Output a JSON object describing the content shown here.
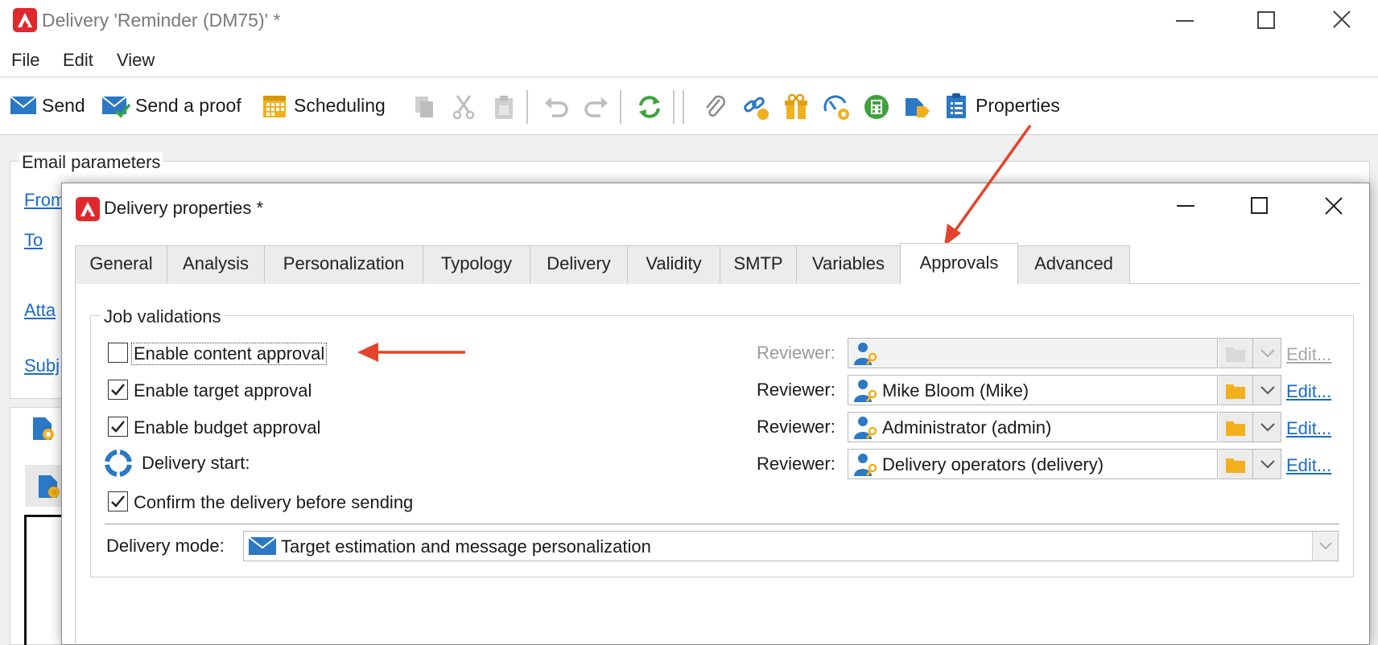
{
  "colors": {
    "accent_red": "#e0282d",
    "link_blue": "#1b6ac9",
    "annotation_arrow": "#e5432b",
    "icon_blue": "#2b78c5",
    "icon_yellow": "#f2b01e",
    "icon_green": "#3ea33a"
  },
  "main_window": {
    "title": "Delivery 'Reminder (DM75)' *",
    "logo_icon": "adobe-campaign-logo-icon",
    "controls": [
      "minimize-icon",
      "maximize-icon",
      "close-icon"
    ]
  },
  "menu": {
    "items": [
      "File",
      "Edit",
      "View"
    ]
  },
  "toolbar": {
    "send_label": "Send",
    "send_proof_label": "Send a proof",
    "scheduling_label": "Scheduling",
    "properties_label": "Properties",
    "icons": [
      "send-icon",
      "send-proof-icon",
      "scheduling-icon",
      "copy-icon",
      "cut-icon",
      "paste-icon",
      "undo-icon",
      "redo-icon",
      "refresh-icon",
      "attachment-icon",
      "link-icon",
      "offers-icon",
      "audit-icon",
      "calculator-icon",
      "tags-icon",
      "properties-icon"
    ]
  },
  "background_form": {
    "group_title": "Email parameters",
    "links": [
      "From",
      "To",
      "Atta",
      "Subj"
    ]
  },
  "dialog": {
    "title": "Delivery properties *",
    "tabs": [
      "General",
      "Analysis",
      "Personalization",
      "Typology",
      "Delivery",
      "Validity",
      "SMTP",
      "Variables",
      "Approvals",
      "Advanced"
    ],
    "active_tab": "Approvals",
    "job_validations": {
      "title": "Job validations",
      "content_approval": {
        "label": "Enable content approval",
        "checked": false
      },
      "target_approval": {
        "label": "Enable target approval",
        "checked": true
      },
      "budget_approval": {
        "label": "Enable budget approval",
        "checked": true
      },
      "delivery_start": {
        "label": "Delivery start:"
      },
      "confirm_delivery": {
        "label": "Confirm the delivery before sending",
        "checked": true
      },
      "reviewer_label": "Reviewer:",
      "edit_label": "Edit...",
      "reviewers": [
        "",
        "Mike Bloom (Mike)",
        "Administrator (admin)",
        "Delivery operators (delivery)"
      ]
    },
    "delivery_mode": {
      "label": "Delivery mode:",
      "value": "Target estimation and message personalization"
    }
  }
}
